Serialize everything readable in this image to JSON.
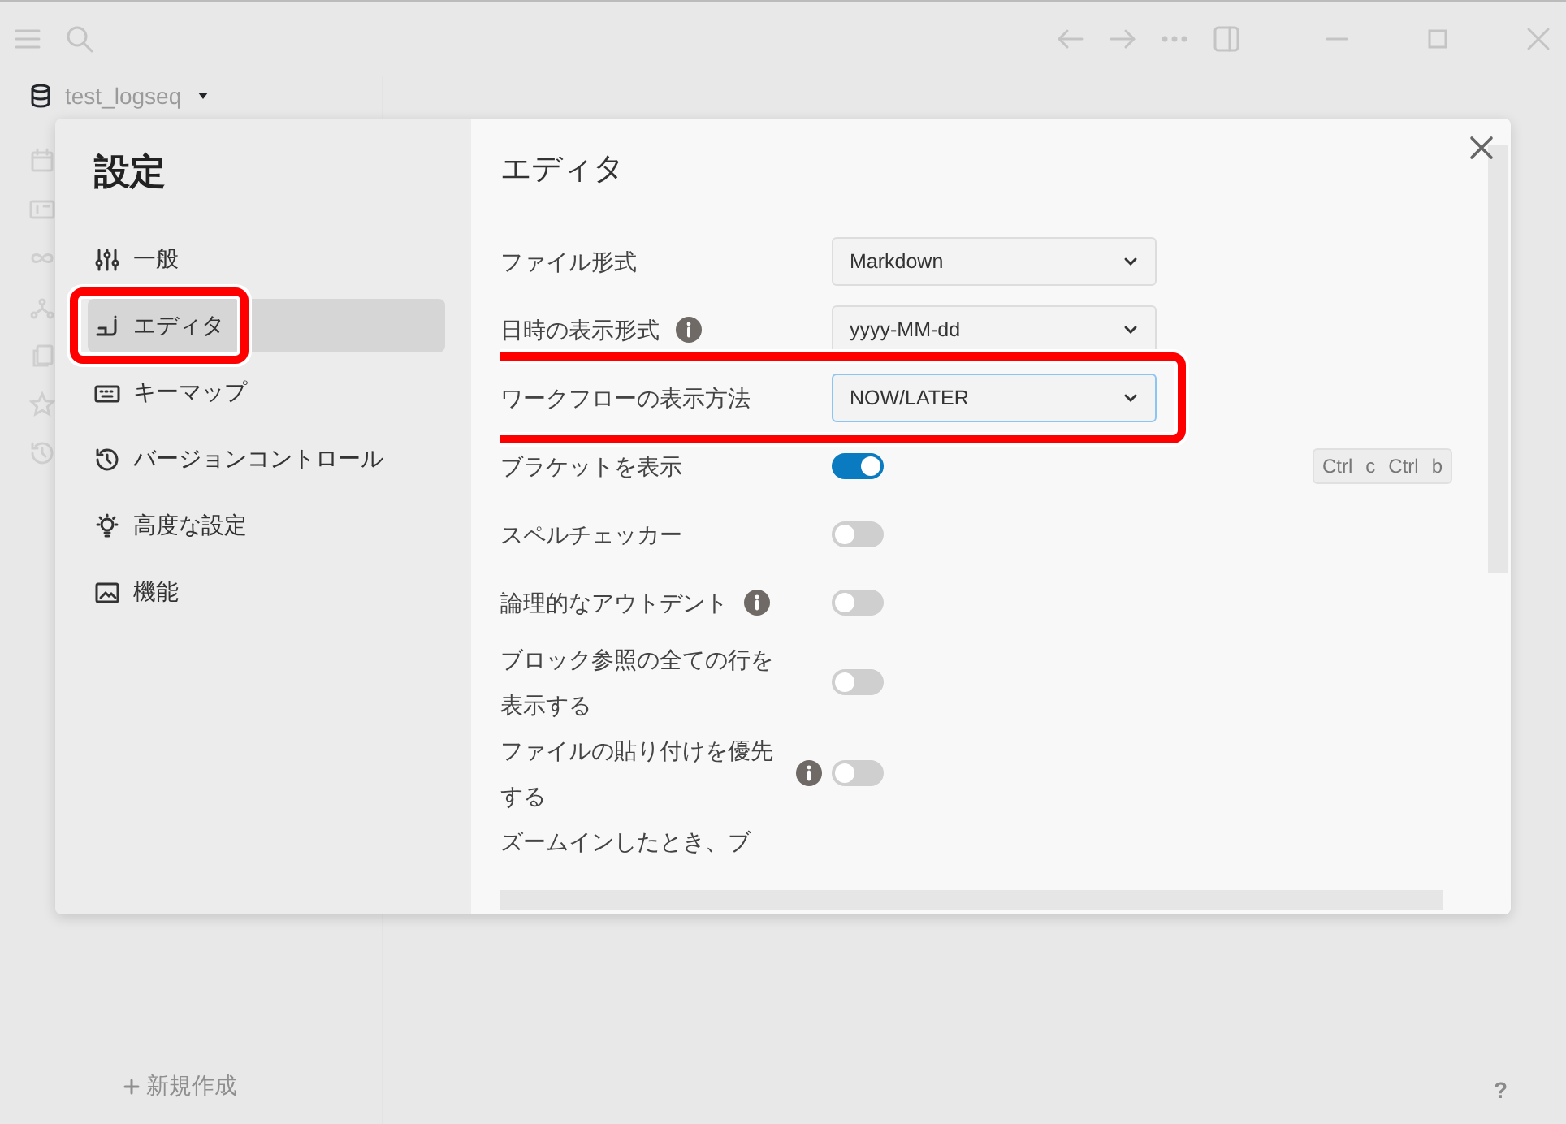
{
  "app": {
    "graph_name": "test_logseq",
    "new_page": "新規作成",
    "help": "?"
  },
  "settings": {
    "title": "設定",
    "menu": [
      {
        "label": "一般",
        "selected": false
      },
      {
        "label": "エディタ",
        "selected": true,
        "highlighted": true
      },
      {
        "label": "キーマップ",
        "selected": false
      },
      {
        "label": "バージョンコントロール",
        "selected": false
      },
      {
        "label": "高度な設定",
        "selected": false
      },
      {
        "label": "機能",
        "selected": false
      }
    ],
    "section_title": "エディタ",
    "rows": [
      {
        "kind": "select",
        "label": "ファイル形式",
        "value": "Markdown"
      },
      {
        "kind": "select",
        "label": "日時の表示形式",
        "value": "yyyy-MM-dd",
        "info": true
      },
      {
        "kind": "select",
        "label": "ワークフローの表示方法",
        "value": "NOW/LATER",
        "focused": true,
        "highlighted": true
      },
      {
        "kind": "toggle",
        "label": "ブラケットを表示",
        "on": true,
        "shortcut": [
          "Ctrl",
          "c",
          "Ctrl",
          "b"
        ]
      },
      {
        "kind": "toggle",
        "label": "スペルチェッカー",
        "on": false
      },
      {
        "kind": "toggle",
        "label": "論理的なアウトデント",
        "on": false,
        "info": true
      },
      {
        "kind": "toggle",
        "label": "ブロック参照の全ての行を表示する",
        "on": false
      },
      {
        "kind": "toggle",
        "label": "ファイルの貼り付けを優先する",
        "on": false,
        "info": true
      },
      {
        "kind": "toggle",
        "label": "ズームインしたとき、ブ"
      }
    ]
  }
}
